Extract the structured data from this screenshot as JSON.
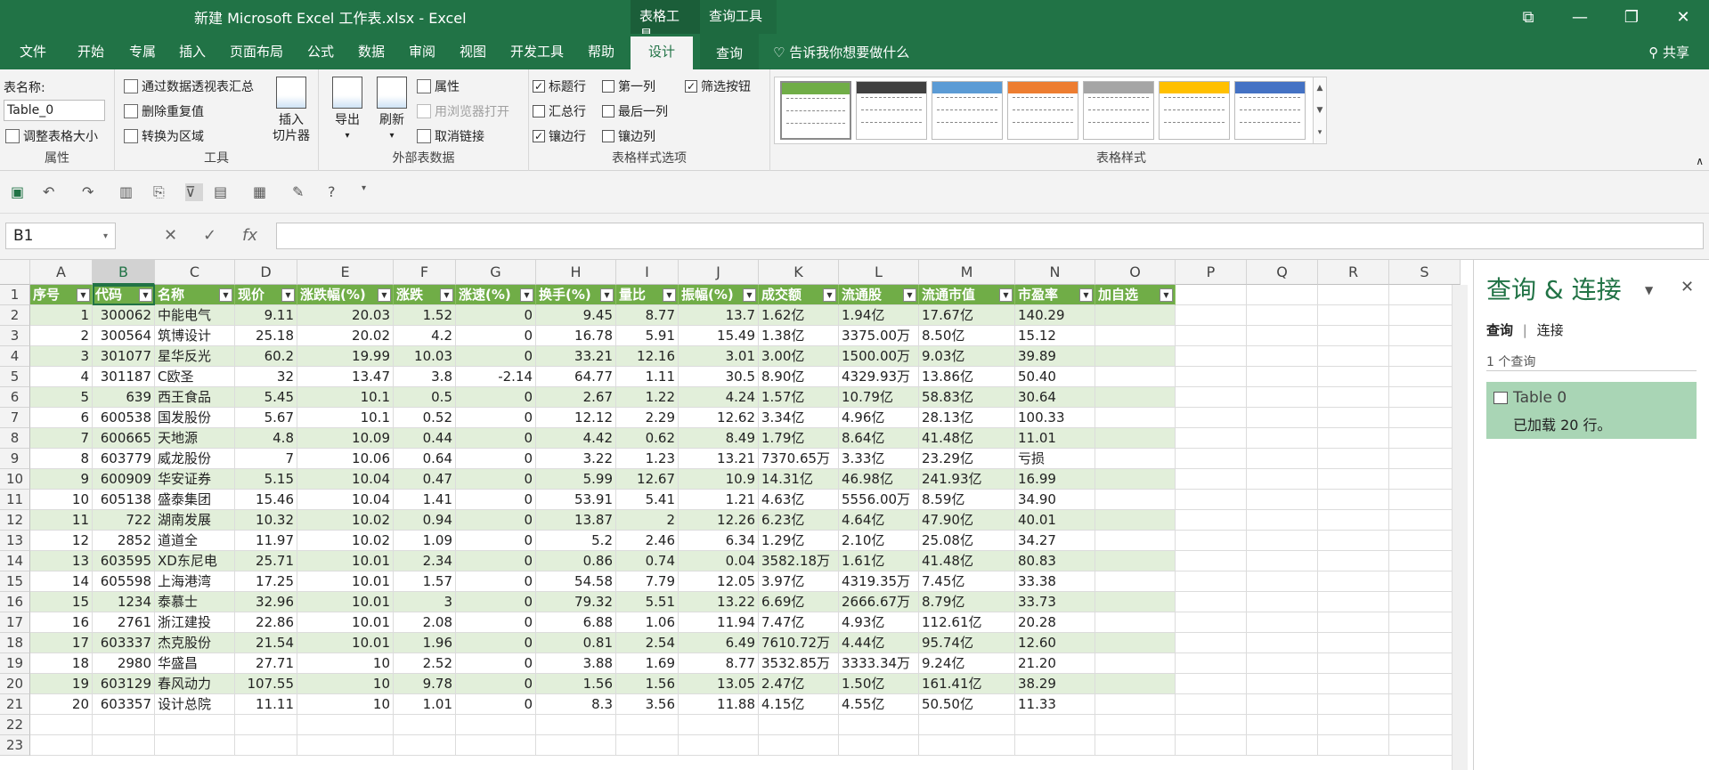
{
  "window": {
    "title": "新建 Microsoft Excel 工作表.xlsx  -  Excel",
    "context_tab1": "表格工具",
    "context_tab2": "查询工具"
  },
  "tabs": [
    "文件",
    "开始",
    "专属",
    "插入",
    "页面布局",
    "公式",
    "数据",
    "审阅",
    "视图",
    "开发工具",
    "帮助",
    "设计",
    "查询"
  ],
  "tellme": "告诉我你想要做什么",
  "share": "共享",
  "ribbon": {
    "props": {
      "name_label": "表名称:",
      "name_value": "Table_0",
      "resize": "调整表格大小",
      "label": "属性"
    },
    "tools": {
      "pivot": "通过数据透视表汇总",
      "dedupe": "删除重复值",
      "convert": "转换为区域",
      "slicer": "插入\n切片器",
      "label": "工具"
    },
    "external": {
      "export": "导出",
      "refresh": "刷新",
      "properties": "属性",
      "browser": "用浏览器打开",
      "unlink": "取消链接",
      "label": "外部表数据"
    },
    "options": {
      "header_row": "标题行",
      "total_row": "汇总行",
      "banded_rows": "镶边行",
      "first_col": "第一列",
      "last_col": "最后一列",
      "banded_cols": "镶边列",
      "filter_btn": "筛选按钮",
      "label": "表格样式选项"
    },
    "styles": {
      "label": "表格样式",
      "colors": [
        "#70ad47",
        "#404040",
        "#5b9bd5",
        "#ed7d31",
        "#a5a5a5",
        "#ffc000",
        "#4472c4"
      ]
    }
  },
  "namebox": "B1",
  "columns": [
    "A",
    "B",
    "C",
    "D",
    "E",
    "F",
    "G",
    "H",
    "I",
    "J",
    "K",
    "L",
    "M",
    "N",
    "O",
    "P",
    "Q",
    "R",
    "S"
  ],
  "table": {
    "headers": [
      "序号",
      "代码",
      "名称",
      "现价",
      "涨跌幅(%)",
      "涨跌",
      "涨速(%)",
      "换手(%)",
      "量比",
      "振幅(%)",
      "成交额",
      "流通股",
      "流通市值",
      "市盈率",
      "加自选"
    ],
    "rows": [
      [
        "1",
        "300062",
        "中能电气",
        "9.11",
        "20.03",
        "1.52",
        "0",
        "9.45",
        "8.77",
        "13.7",
        "1.62亿",
        "1.94亿",
        "17.67亿",
        "140.29",
        ""
      ],
      [
        "2",
        "300564",
        "筑博设计",
        "25.18",
        "20.02",
        "4.2",
        "0",
        "16.78",
        "5.91",
        "15.49",
        "1.38亿",
        "3375.00万",
        "8.50亿",
        "15.12",
        ""
      ],
      [
        "3",
        "301077",
        "星华反光",
        "60.2",
        "19.99",
        "10.03",
        "0",
        "33.21",
        "12.16",
        "3.01",
        "3.00亿",
        "1500.00万",
        "9.03亿",
        "39.89",
        ""
      ],
      [
        "4",
        "301187",
        "C欧圣",
        "32",
        "13.47",
        "3.8",
        "-2.14",
        "64.77",
        "1.11",
        "30.5",
        "8.90亿",
        "4329.93万",
        "13.86亿",
        "50.40",
        ""
      ],
      [
        "5",
        "639",
        "西王食品",
        "5.45",
        "10.1",
        "0.5",
        "0",
        "2.67",
        "1.22",
        "4.24",
        "1.57亿",
        "10.79亿",
        "58.83亿",
        "30.64",
        ""
      ],
      [
        "6",
        "600538",
        "国发股份",
        "5.67",
        "10.1",
        "0.52",
        "0",
        "12.12",
        "2.29",
        "12.62",
        "3.34亿",
        "4.96亿",
        "28.13亿",
        "100.33",
        ""
      ],
      [
        "7",
        "600665",
        "天地源",
        "4.8",
        "10.09",
        "0.44",
        "0",
        "4.42",
        "0.62",
        "8.49",
        "1.79亿",
        "8.64亿",
        "41.48亿",
        "11.01",
        ""
      ],
      [
        "8",
        "603779",
        "威龙股份",
        "7",
        "10.06",
        "0.64",
        "0",
        "3.22",
        "1.23",
        "13.21",
        "7370.65万",
        "3.33亿",
        "23.29亿",
        "亏损",
        ""
      ],
      [
        "9",
        "600909",
        "华安证券",
        "5.15",
        "10.04",
        "0.47",
        "0",
        "5.99",
        "12.67",
        "10.9",
        "14.31亿",
        "46.98亿",
        "241.93亿",
        "16.99",
        ""
      ],
      [
        "10",
        "605138",
        "盛泰集团",
        "15.46",
        "10.04",
        "1.41",
        "0",
        "53.91",
        "5.41",
        "1.21",
        "4.63亿",
        "5556.00万",
        "8.59亿",
        "34.90",
        ""
      ],
      [
        "11",
        "722",
        "湖南发展",
        "10.32",
        "10.02",
        "0.94",
        "0",
        "13.87",
        "2",
        "12.26",
        "6.23亿",
        "4.64亿",
        "47.90亿",
        "40.01",
        ""
      ],
      [
        "12",
        "2852",
        "道道全",
        "11.97",
        "10.02",
        "1.09",
        "0",
        "5.2",
        "2.46",
        "6.34",
        "1.29亿",
        "2.10亿",
        "25.08亿",
        "34.27",
        ""
      ],
      [
        "13",
        "603595",
        "XD东尼电",
        "25.71",
        "10.01",
        "2.34",
        "0",
        "0.86",
        "0.74",
        "0.04",
        "3582.18万",
        "1.61亿",
        "41.48亿",
        "80.83",
        ""
      ],
      [
        "14",
        "605598",
        "上海港湾",
        "17.25",
        "10.01",
        "1.57",
        "0",
        "54.58",
        "7.79",
        "12.05",
        "3.97亿",
        "4319.35万",
        "7.45亿",
        "33.38",
        ""
      ],
      [
        "15",
        "1234",
        "泰慕士",
        "32.96",
        "10.01",
        "3",
        "0",
        "79.32",
        "5.51",
        "13.22",
        "6.69亿",
        "2666.67万",
        "8.79亿",
        "33.73",
        ""
      ],
      [
        "16",
        "2761",
        "浙江建投",
        "22.86",
        "10.01",
        "2.08",
        "0",
        "6.88",
        "1.06",
        "11.94",
        "7.47亿",
        "4.93亿",
        "112.61亿",
        "20.28",
        ""
      ],
      [
        "17",
        "603337",
        "杰克股份",
        "21.54",
        "10.01",
        "1.96",
        "0",
        "0.81",
        "2.54",
        "6.49",
        "7610.72万",
        "4.44亿",
        "95.74亿",
        "12.60",
        ""
      ],
      [
        "18",
        "2980",
        "华盛昌",
        "27.71",
        "10",
        "2.52",
        "0",
        "3.88",
        "1.69",
        "8.77",
        "3532.85万",
        "3333.34万",
        "9.24亿",
        "21.20",
        ""
      ],
      [
        "19",
        "603129",
        "春风动力",
        "107.55",
        "10",
        "9.78",
        "0",
        "1.56",
        "1.56",
        "13.05",
        "2.47亿",
        "1.50亿",
        "161.41亿",
        "38.29",
        ""
      ],
      [
        "20",
        "603357",
        "设计总院",
        "11.11",
        "10",
        "1.01",
        "0",
        "8.3",
        "3.56",
        "11.88",
        "4.15亿",
        "4.55亿",
        "50.50亿",
        "11.33",
        ""
      ]
    ]
  },
  "pane": {
    "title": "查询 & 连接",
    "tab1": "查询",
    "tab2": "连接",
    "count": "1 个查询",
    "query_name": "Table 0",
    "query_status": "已加载 20 行。"
  }
}
